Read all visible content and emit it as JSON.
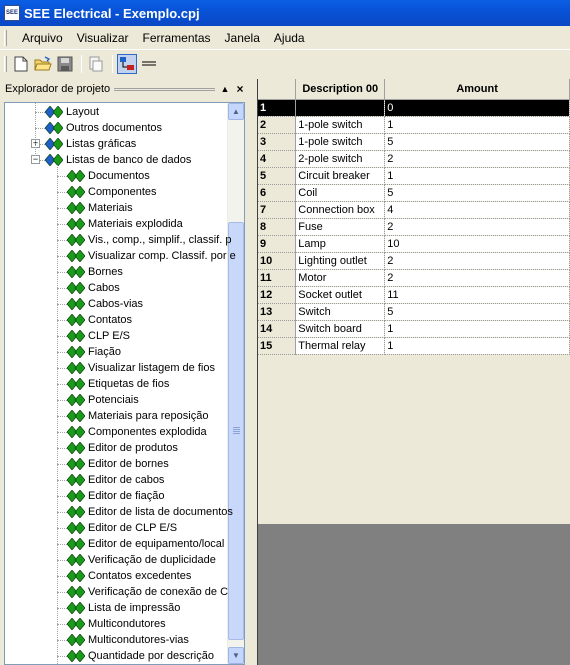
{
  "window": {
    "title": "SEE Electrical - Exemplo.cpj",
    "icon_label": "SEE"
  },
  "menu": {
    "items": [
      "Arquivo",
      "Visualizar",
      "Ferramentas",
      "Janela",
      "Ajuda"
    ]
  },
  "toolbar": {
    "buttons": [
      "new-file-icon",
      "open-folder-icon",
      "save-icon",
      "print-preview-icon",
      "tree-view-icon",
      "lines-icon"
    ]
  },
  "explorer": {
    "title": "Explorador de projeto",
    "pin_symbol": "▲",
    "close_symbol": "×",
    "tree": [
      {
        "label": "Layout",
        "icon": "diamond-pair-icon"
      },
      {
        "label": "Outros documentos",
        "icon": "diamond-pair-icon"
      },
      {
        "label": "Listas gráficas",
        "icon": "diamond-pair-icon",
        "expander": "+"
      },
      {
        "label": "Listas de banco de dados",
        "icon": "diamond-pair-icon",
        "expander": "−"
      },
      {
        "label": "Documentos",
        "icon": "green-diamond-icon"
      },
      {
        "label": "Componentes",
        "icon": "green-diamond-icon"
      },
      {
        "label": "Materiais",
        "icon": "green-diamond-icon"
      },
      {
        "label": "Materiais explodida",
        "icon": "green-diamond-icon"
      },
      {
        "label": "Vis., comp., simplif., classif. p",
        "icon": "green-diamond-icon"
      },
      {
        "label": "Visualizar comp. Classif. por e",
        "icon": "green-diamond-icon"
      },
      {
        "label": "Bornes",
        "icon": "green-diamond-icon"
      },
      {
        "label": "Cabos",
        "icon": "green-diamond-icon"
      },
      {
        "label": "Cabos-vias",
        "icon": "green-diamond-icon"
      },
      {
        "label": "Contatos",
        "icon": "green-diamond-icon"
      },
      {
        "label": "CLP E/S",
        "icon": "green-diamond-icon"
      },
      {
        "label": "Fiação",
        "icon": "green-diamond-icon"
      },
      {
        "label": "Visualizar listagem de fios",
        "icon": "green-diamond-icon"
      },
      {
        "label": "Etiquetas de fios",
        "icon": "green-diamond-icon"
      },
      {
        "label": "Potenciais",
        "icon": "green-diamond-icon"
      },
      {
        "label": "Materiais para reposição",
        "icon": "green-diamond-icon"
      },
      {
        "label": "Componentes explodida",
        "icon": "green-diamond-icon"
      },
      {
        "label": "Editor de produtos",
        "icon": "green-diamond-icon"
      },
      {
        "label": "Editor de bornes",
        "icon": "green-diamond-icon"
      },
      {
        "label": "Editor de cabos",
        "icon": "green-diamond-icon"
      },
      {
        "label": "Editor de fiação",
        "icon": "green-diamond-icon"
      },
      {
        "label": "Editor de lista de documentos",
        "icon": "green-diamond-icon"
      },
      {
        "label": "Editor de CLP E/S",
        "icon": "green-diamond-icon"
      },
      {
        "label": "Editor de equipamento/local",
        "icon": "green-diamond-icon"
      },
      {
        "label": "Verificação de duplicidade",
        "icon": "green-diamond-icon"
      },
      {
        "label": "Contatos excedentes",
        "icon": "green-diamond-icon"
      },
      {
        "label": "Verificação de conexão de C",
        "icon": "green-diamond-icon"
      },
      {
        "label": "Lista de impressão",
        "icon": "green-diamond-icon"
      },
      {
        "label": "Multicondutores",
        "icon": "green-diamond-icon"
      },
      {
        "label": "Multicondutores-vias",
        "icon": "green-diamond-icon"
      },
      {
        "label": "Quantidade por descrição",
        "icon": "green-diamond-icon"
      }
    ]
  },
  "grid": {
    "headers": [
      "",
      "Description 00",
      "Amount"
    ],
    "rows": [
      {
        "num": "1",
        "desc": "",
        "amount": "0",
        "selected": true
      },
      {
        "num": "2",
        "desc": "1-pole switch",
        "amount": "1"
      },
      {
        "num": "3",
        "desc": "1-pole switch",
        "amount": "5"
      },
      {
        "num": "4",
        "desc": "2-pole switch",
        "amount": "2"
      },
      {
        "num": "5",
        "desc": "Circuit breaker",
        "amount": "1"
      },
      {
        "num": "6",
        "desc": "Coil",
        "amount": "5"
      },
      {
        "num": "7",
        "desc": "Connection box",
        "amount": "4"
      },
      {
        "num": "8",
        "desc": "Fuse",
        "amount": "2"
      },
      {
        "num": "9",
        "desc": "Lamp",
        "amount": "10"
      },
      {
        "num": "10",
        "desc": "Lighting outlet",
        "amount": "2"
      },
      {
        "num": "11",
        "desc": "Motor",
        "amount": "2"
      },
      {
        "num": "12",
        "desc": "Socket outlet",
        "amount": "11"
      },
      {
        "num": "13",
        "desc": "Switch",
        "amount": "5"
      },
      {
        "num": "14",
        "desc": "Switch board",
        "amount": "1"
      },
      {
        "num": "15",
        "desc": "Thermal relay",
        "amount": "1"
      }
    ]
  },
  "colors": {
    "titlebar": "#0a5fe4",
    "selection": "#000000",
    "tree_icon_green": "#1a9a1a",
    "tree_icon_blue": "#1f5fc8",
    "empty_area": "#808080"
  }
}
